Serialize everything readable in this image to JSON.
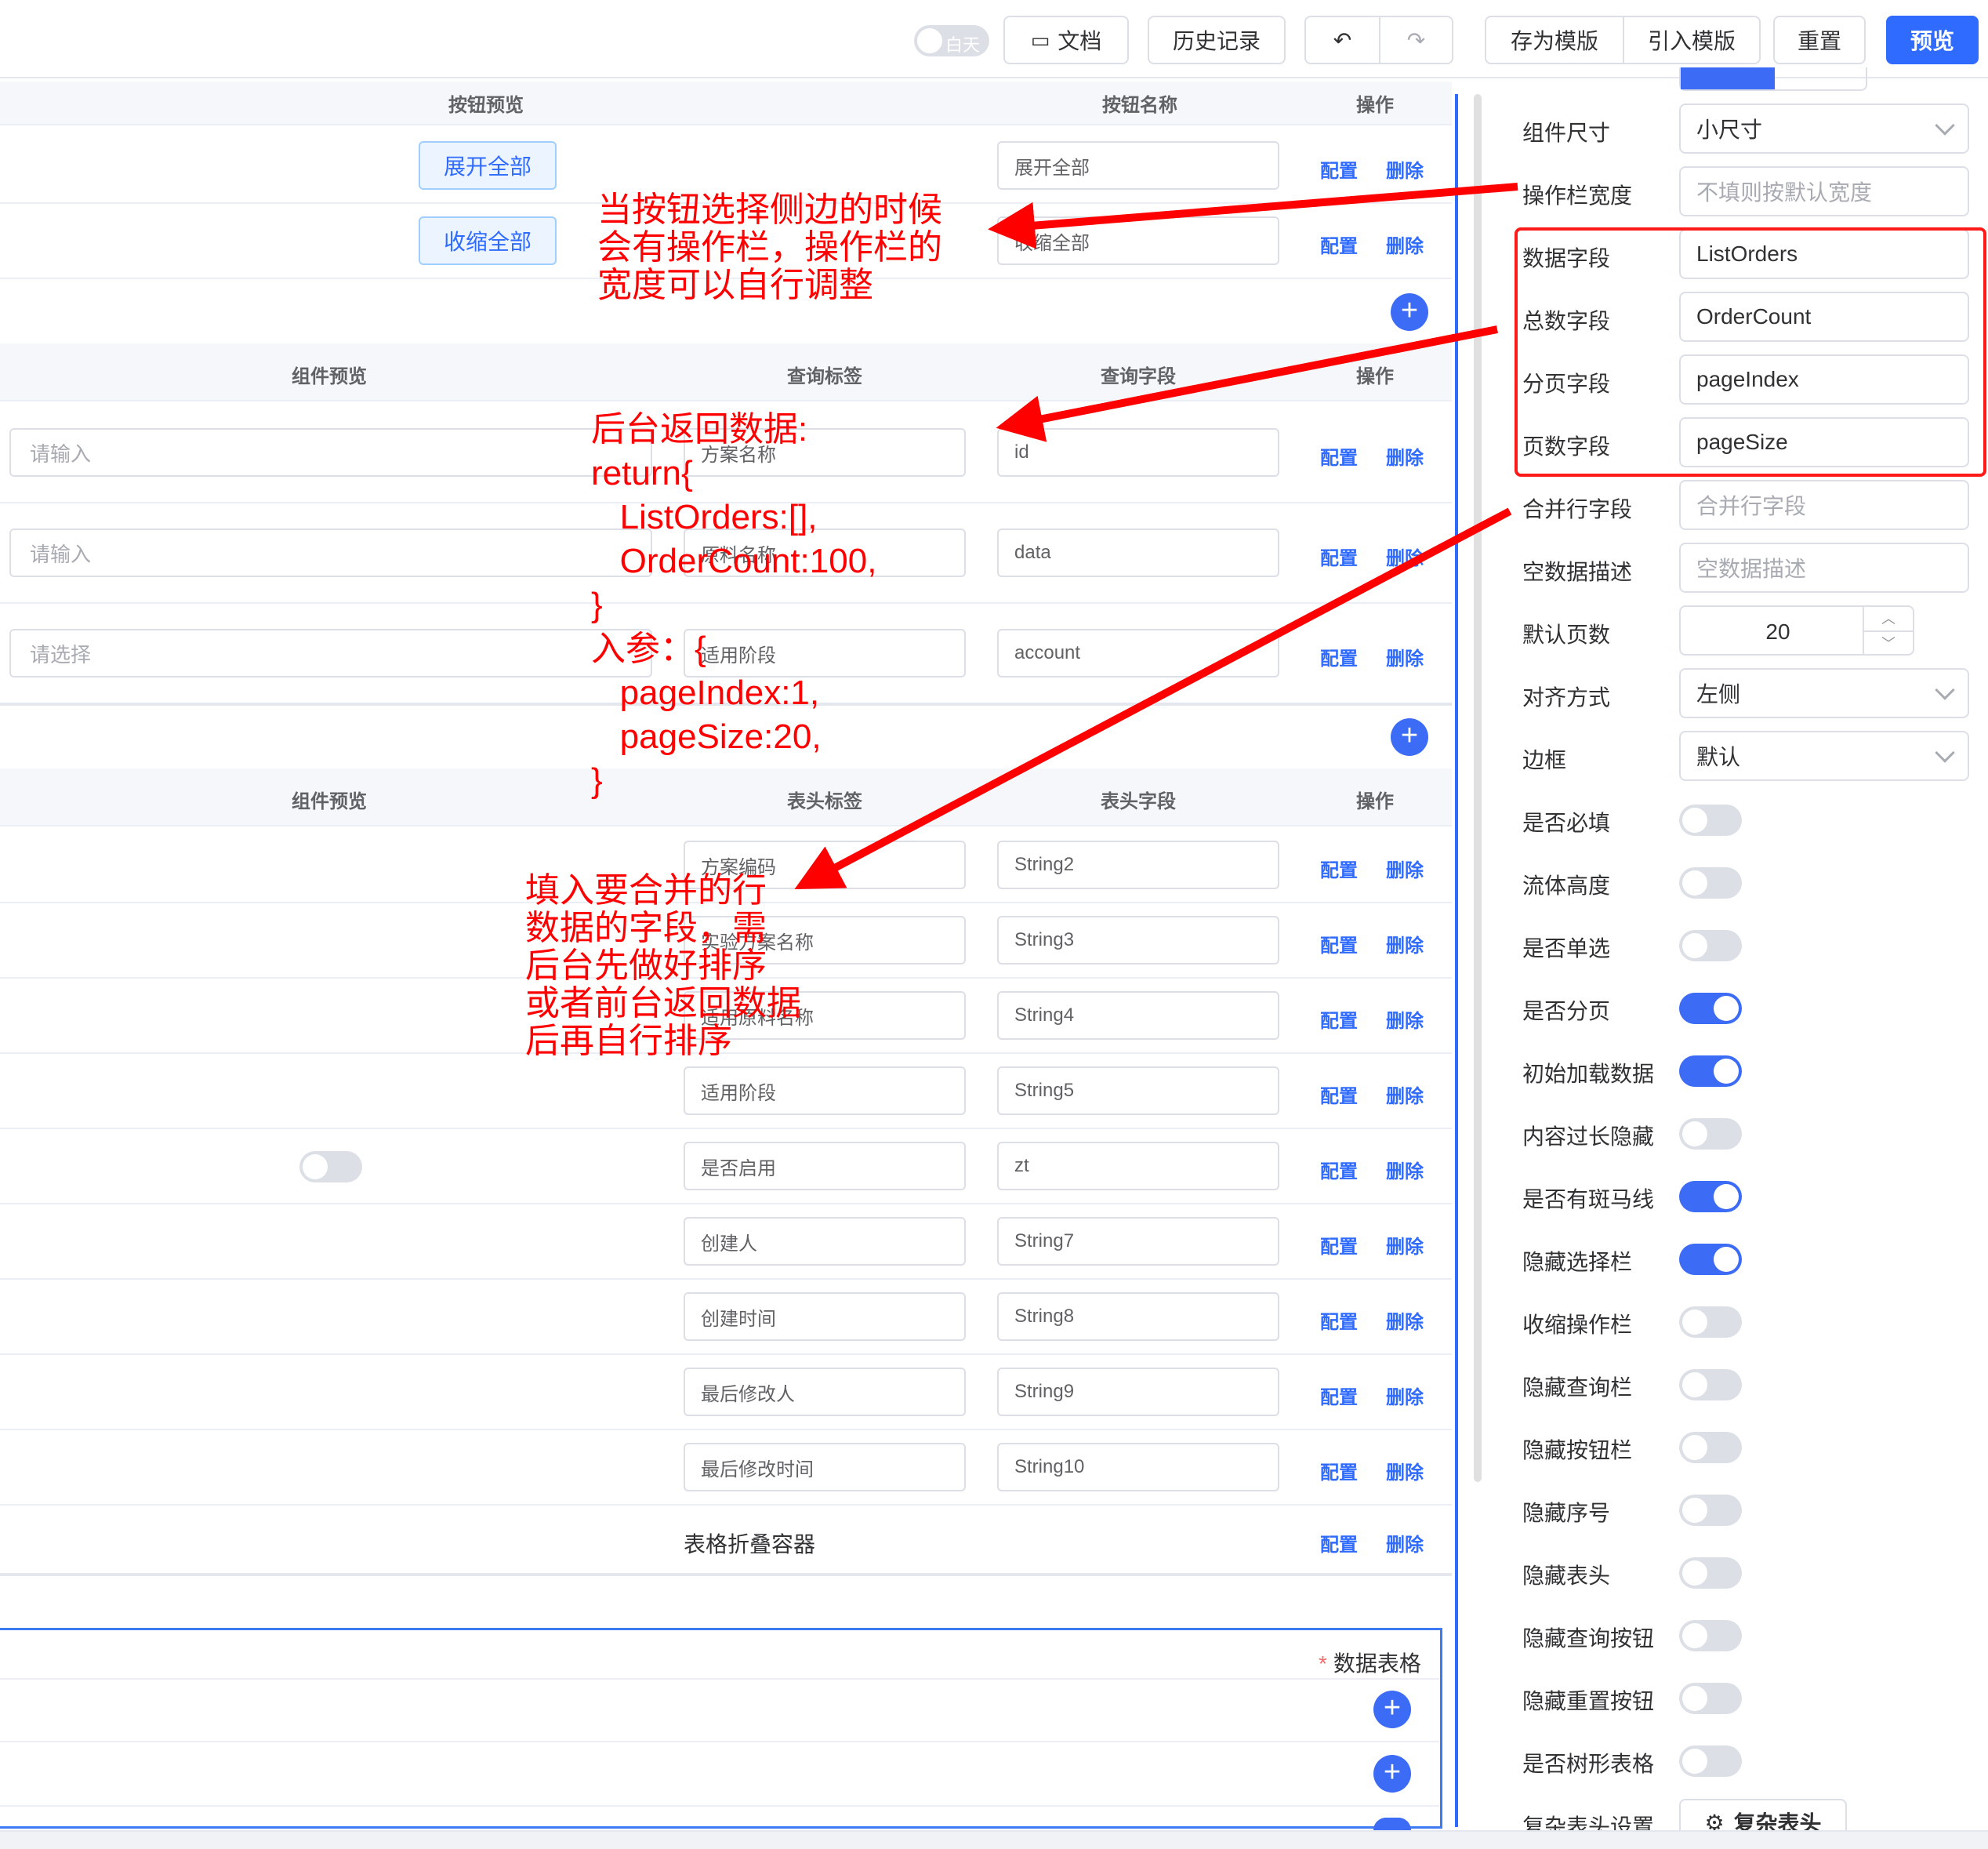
{
  "toolbar": {
    "theme_label": "白天",
    "docs": "文档",
    "history": "历史记录",
    "save_template": "存为模版",
    "import_template": "引入模版",
    "reset": "重置",
    "preview": "预览"
  },
  "buttons_table": {
    "headers": {
      "preview": "按钮预览",
      "name": "按钮名称",
      "ops": "操作"
    },
    "rows": [
      {
        "preview": "展开全部",
        "name": "展开全部"
      },
      {
        "preview": "收缩全部",
        "name": "收缩全部"
      }
    ]
  },
  "query_table": {
    "headers": {
      "preview": "组件预览",
      "label": "查询标签",
      "field": "查询字段",
      "ops": "操作"
    },
    "rows": [
      {
        "preview": "请输入",
        "label": "方案名称",
        "field": "id"
      },
      {
        "preview": "请输入",
        "label": "原料名称",
        "field": "data"
      },
      {
        "preview": "请选择",
        "label": "适用阶段",
        "field": "account"
      }
    ]
  },
  "column_table": {
    "headers": {
      "preview": "组件预览",
      "label": "表头标签",
      "field": "表头字段",
      "ops": "操作"
    },
    "rows": [
      {
        "label": "方案编码",
        "field": "String2"
      },
      {
        "label": "实验方案名称",
        "field": "String3"
      },
      {
        "label": "适用原料名称",
        "field": "String4"
      },
      {
        "label": "适用阶段",
        "field": "String5"
      },
      {
        "label": "是否启用",
        "field": "zt"
      },
      {
        "label": "创建人",
        "field": "String7"
      },
      {
        "label": "创建时间",
        "field": "String8"
      },
      {
        "label": "最后修改人",
        "field": "String9"
      },
      {
        "label": "最后修改时间",
        "field": "String10"
      }
    ],
    "collapse_container": "表格折叠容器"
  },
  "ops": {
    "config": "配置",
    "delete": "删除"
  },
  "datatable": {
    "title": "数据表格"
  },
  "panel": {
    "size_label": "组件尺寸",
    "size_value": "小尺寸",
    "opwidth_label": "操作栏宽度",
    "opwidth_placeholder": "不填则按默认宽度",
    "data_field_label": "数据字段",
    "data_field_value": "ListOrders",
    "total_field_label": "总数字段",
    "total_field_value": "OrderCount",
    "page_field_label": "分页字段",
    "page_field_value": "pageIndex",
    "pagesize_field_label": "页数字段",
    "pagesize_field_value": "pageSize",
    "merge_label": "合并行字段",
    "merge_placeholder": "合并行字段",
    "empty_label": "空数据描述",
    "empty_placeholder": "空数据描述",
    "default_page_label": "默认页数",
    "default_page_value": "20",
    "align_label": "对齐方式",
    "align_value": "左侧",
    "border_label": "边框",
    "border_value": "默认",
    "switches": [
      {
        "label": "是否必填",
        "on": false
      },
      {
        "label": "流体高度",
        "on": false
      },
      {
        "label": "是否单选",
        "on": false
      },
      {
        "label": "是否分页",
        "on": true
      },
      {
        "label": "初始加载数据",
        "on": true
      },
      {
        "label": "内容过长隐藏",
        "on": false
      },
      {
        "label": "是否有斑马线",
        "on": true
      },
      {
        "label": "隐藏选择栏",
        "on": true
      },
      {
        "label": "收缩操作栏",
        "on": false
      },
      {
        "label": "隐藏查询栏",
        "on": false
      },
      {
        "label": "隐藏按钮栏",
        "on": false
      },
      {
        "label": "隐藏序号",
        "on": false
      },
      {
        "label": "隐藏表头",
        "on": false
      },
      {
        "label": "隐藏查询按钮",
        "on": false
      },
      {
        "label": "隐藏重置按钮",
        "on": false
      },
      {
        "label": "是否树形表格",
        "on": false
      }
    ],
    "complex_header_label": "复杂表头设置",
    "complex_header_button": "复杂表头"
  },
  "annotations": {
    "opwidth_note": "当按钮选择侧边的时候\n会有操作栏，操作栏的\n宽度可以自行调整",
    "backend_note": "后台返回数据:\nreturn{\n   ListOrders:[],\n   OrderCount:100,\n}\n入参：{\n   pageIndex:1,\n   pageSize:20,\n}",
    "merge_note": "填入要合并的行\n数据的字段，需\n后台先做好排序\n或者前台返回数据\n后再自行排序"
  },
  "colors": {
    "accent": "#2f6bff",
    "annotation": "#ff0000",
    "switch_on": "#3c6cf5"
  }
}
